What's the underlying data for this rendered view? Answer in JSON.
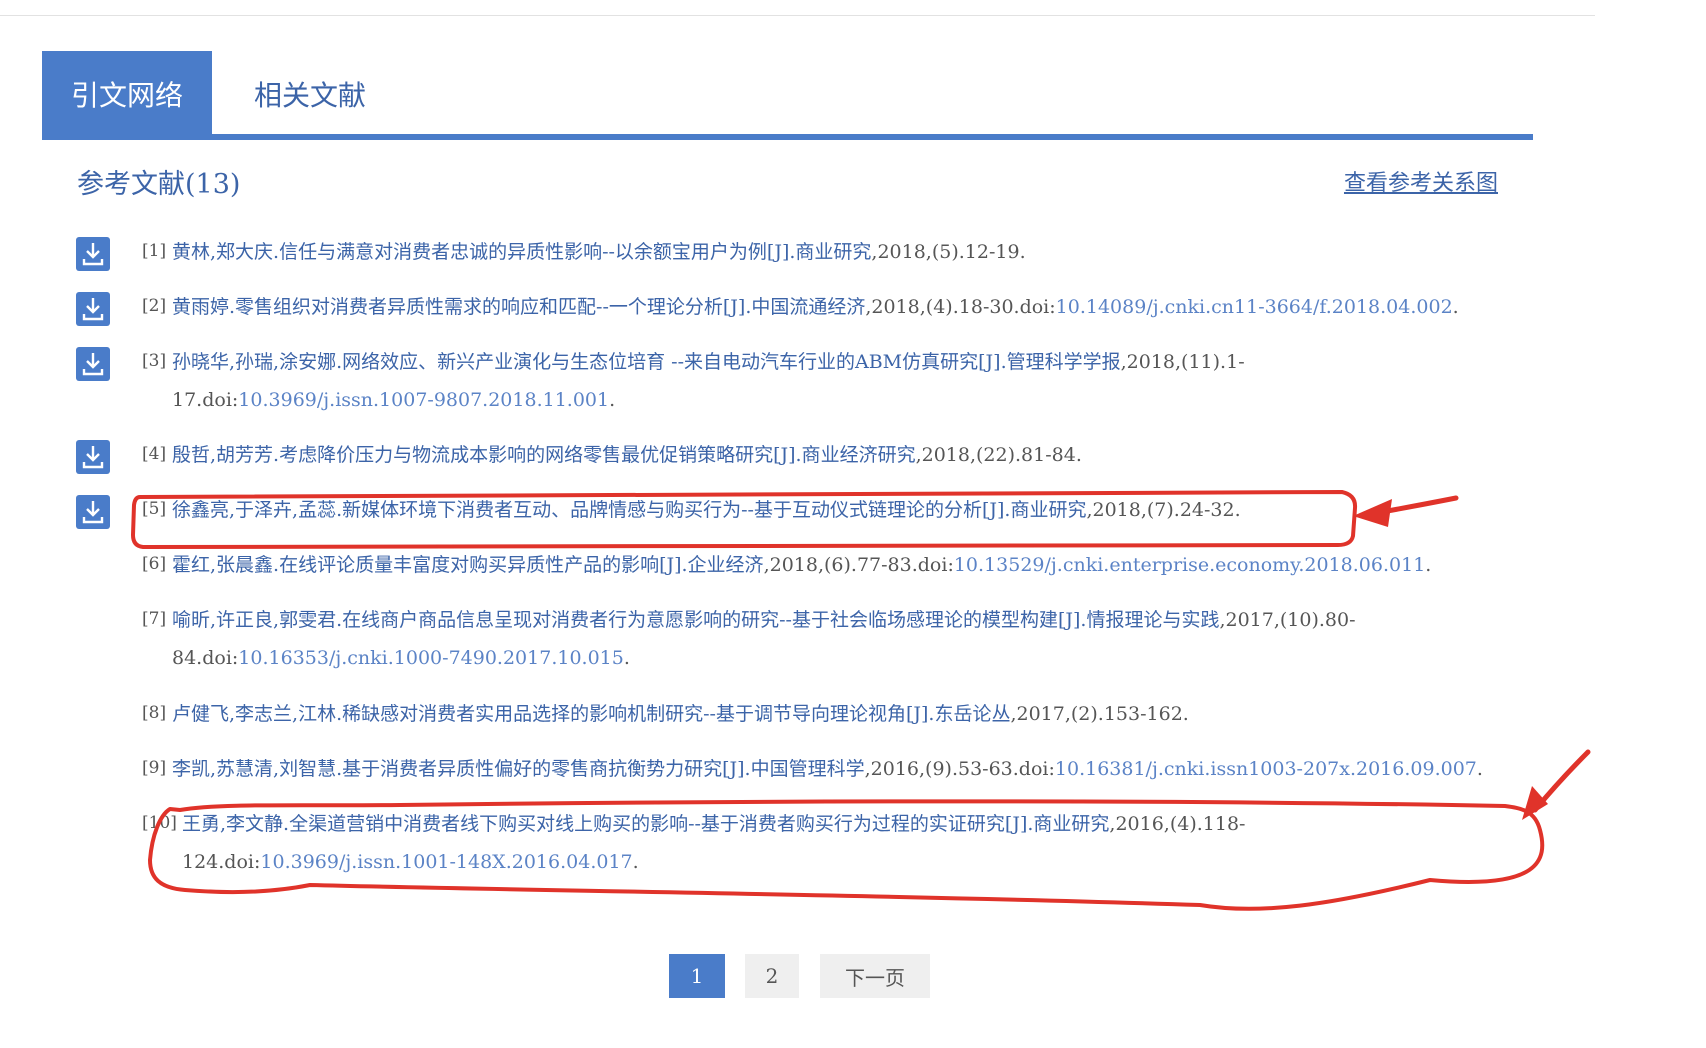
{
  "tabs": [
    {
      "label": "引文网络",
      "active": true
    },
    {
      "label": "相关文献",
      "active": false
    }
  ],
  "section": {
    "title": "参考文献(13)",
    "view_graph_link": "查看参考关系图"
  },
  "references": [
    {
      "num": "[1]",
      "title": "黄林,郑大庆.信任与满意对消费者忠诚的异质性影响--以余额宝用户为例[J].商业研究",
      "meta": ",2018,(5).12-19.",
      "doi": "",
      "end": ""
    },
    {
      "num": "[2]",
      "title": "黄雨婷.零售组织对消费者异质性需求的响应和匹配--一个理论分析[J].中国流通经济",
      "meta": ",2018,(4).18-30.doi:",
      "doi": "10.14089/j.cnki.cn11-3664/f.2018.04.002",
      "end": "."
    },
    {
      "num": "[3]",
      "title": "孙晓华,孙瑞,涂安娜.网络效应、新兴产业演化与生态位培育 --来自电动汽车行业的ABM仿真研究[J].管理科学学报",
      "meta": ",2018,(11).1-17.doi:",
      "doi": "10.3969/j.issn.1007-9807.2018.11.001",
      "end": "."
    },
    {
      "num": "[4]",
      "title": "殷哲,胡芳芳.考虑降价压力与物流成本影响的网络零售最优促销策略研究[J].商业经济研究",
      "meta": ",2018,(22).81-84.",
      "doi": "",
      "end": ""
    },
    {
      "num": "[5]",
      "title": "徐鑫亮,于泽卉,孟蕊.新媒体环境下消费者互动、品牌情感与购买行为--基于互动仪式链理论的分析[J].商业研究",
      "meta": ",2018,(7).24-32.",
      "doi": "",
      "end": ""
    },
    {
      "num": "[6]",
      "title": "霍红,张晨鑫.在线评论质量丰富度对购买异质性产品的影响[J].企业经济",
      "meta": ",2018,(6).77-83.doi:",
      "doi": "10.13529/j.cnki.enterprise.economy.2018.06.011",
      "end": "."
    },
    {
      "num": "[7]",
      "title": "喻昕,许正良,郭雯君.在线商户商品信息呈现对消费者行为意愿影响的研究--基于社会临场感理论的模型构建[J].情报理论与实践",
      "meta": ",2017,(10).80-84.doi:",
      "doi": "10.16353/j.cnki.1000-7490.2017.10.015",
      "end": "."
    },
    {
      "num": "[8]",
      "title": "卢健飞,李志兰,江林.稀缺感对消费者实用品选择的影响机制研究--基于调节导向理论视角[J].东岳论丛",
      "meta": ",2017,(2).153-162.",
      "doi": "",
      "end": ""
    },
    {
      "num": "[9]",
      "title": "李凯,苏慧清,刘智慧.基于消费者异质性偏好的零售商抗衡势力研究[J].中国管理科学",
      "meta": ",2016,(9).53-63.doi:",
      "doi": "10.16381/j.cnki.issn1003-207x.2016.09.007",
      "end": "."
    },
    {
      "num": "[10]",
      "title": "王勇,李文静.全渠道营销中消费者线下购买对线上购买的影响--基于消费者购买行为过程的实证研究[J].商业研究",
      "meta": ",2016,(4).118-124.doi:",
      "doi": "10.3969/j.issn.1001-148X.2016.04.017",
      "end": "."
    }
  ],
  "pagination": {
    "pages": [
      "1",
      "2"
    ],
    "current": "1",
    "next_label": "下一页"
  },
  "colors": {
    "accent": "#4a7cc9",
    "link": "#3c64a8",
    "annotation": "#e0332a"
  }
}
